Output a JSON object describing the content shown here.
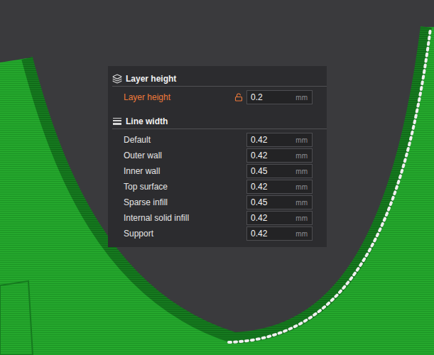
{
  "panel": {
    "sections": [
      {
        "title": "Layer height",
        "kind": "layers",
        "rows": [
          {
            "label": "Layer height",
            "value": "0.2",
            "unit": "mm",
            "modified": true,
            "locked": false
          }
        ]
      },
      {
        "title": "Line width",
        "kind": "lines",
        "rows": [
          {
            "label": "Default",
            "value": "0.42",
            "unit": "mm",
            "modified": false
          },
          {
            "label": "Outer wall",
            "value": "0.42",
            "unit": "mm",
            "modified": false
          },
          {
            "label": "Inner wall",
            "value": "0.45",
            "unit": "mm",
            "modified": false
          },
          {
            "label": "Top surface",
            "value": "0.42",
            "unit": "mm",
            "modified": false
          },
          {
            "label": "Sparse infill",
            "value": "0.45",
            "unit": "mm",
            "modified": false
          },
          {
            "label": "Internal solid infill",
            "value": "0.42",
            "unit": "mm",
            "modified": false
          },
          {
            "label": "Support",
            "value": "0.42",
            "unit": "mm",
            "modified": false
          }
        ]
      }
    ]
  }
}
